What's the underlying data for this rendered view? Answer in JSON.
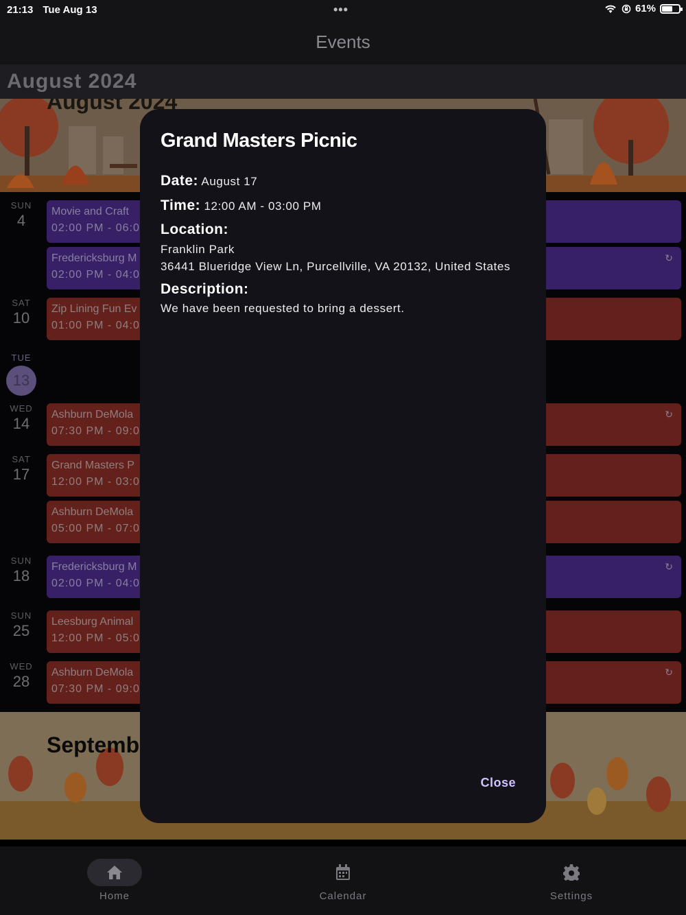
{
  "status_bar": {
    "time": "21:13",
    "date": "Tue Aug 13",
    "battery": "61%",
    "battery_level": 0.61
  },
  "nav": {
    "title": "Events"
  },
  "month_header": "August 2024",
  "banner_aug": "August 2024",
  "banner_sep": "Septemb",
  "days": [
    {
      "weekday": "SUN",
      "num": "4"
    },
    {
      "weekday": "SAT",
      "num": "10"
    },
    {
      "weekday": "TUE",
      "num": "13"
    },
    {
      "weekday": "WED",
      "num": "14"
    },
    {
      "weekday": "SAT",
      "num": "17"
    },
    {
      "weekday": "SUN",
      "num": "18"
    },
    {
      "weekday": "SUN",
      "num": "25"
    },
    {
      "weekday": "WED",
      "num": "28"
    }
  ],
  "events": [
    {
      "title": "Movie and Craft",
      "time": "02:00 PM - 06:0",
      "color": "purple"
    },
    {
      "title": "Fredericksburg M",
      "time": "02:00 PM - 04:0",
      "color": "purple"
    },
    {
      "title": "Zip Lining Fun Ev",
      "time": "01:00 PM - 04:0",
      "color": "red"
    },
    {
      "title": "Ashburn DeMola",
      "time": "07:30 PM - 09:0",
      "color": "red"
    },
    {
      "title": "Grand Masters P",
      "time": "12:00 PM - 03:0",
      "color": "red"
    },
    {
      "title": "Ashburn DeMola",
      "time": "05:00 PM - 07:0",
      "color": "red"
    },
    {
      "title": "Fredericksburg M",
      "time": "02:00 PM - 04:0",
      "color": "purple"
    },
    {
      "title": "Leesburg Animal",
      "time": "12:00 PM - 05:0",
      "color": "red"
    },
    {
      "title": "Ashburn DeMola",
      "time": "07:30 PM - 09:0",
      "color": "red"
    }
  ],
  "modal": {
    "title": "Grand Masters Picnic",
    "date_label": "Date:",
    "date_value": "August 17",
    "time_label": "Time:",
    "time_value": "12:00 AM - 03:00 PM",
    "location_label": "Location:",
    "location_name": "Franklin Park",
    "location_address": "36441 Blueridge View Ln, Purcellville, VA  20132, United States",
    "description_label": "Description:",
    "description_value": "We have been requested to bring a dessert.",
    "close_label": "Close"
  },
  "tabs": [
    {
      "label": "Home",
      "icon": "home-icon"
    },
    {
      "label": "Calendar",
      "icon": "calendar-icon"
    },
    {
      "label": "Settings",
      "icon": "gear-icon"
    }
  ],
  "colors": {
    "red_event": "#64201b",
    "purple_event": "#372066",
    "accent": "#cfc3ff",
    "modal_bg": "#141219"
  }
}
